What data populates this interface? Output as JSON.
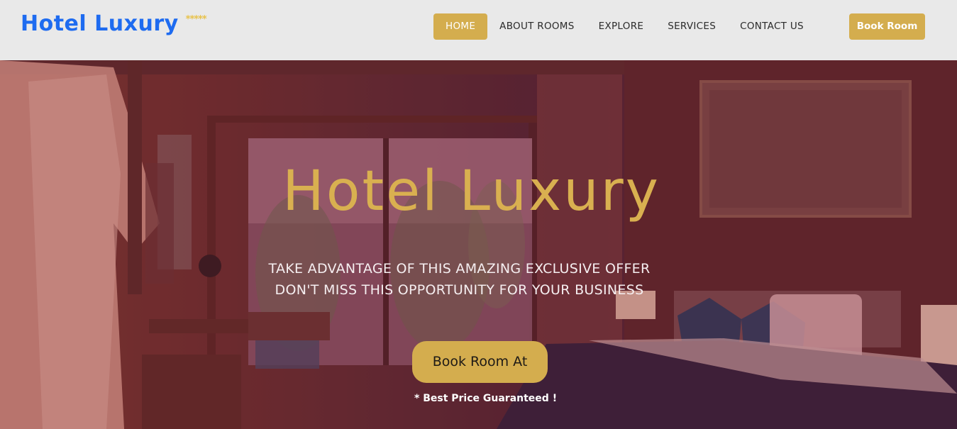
{
  "brand": {
    "name": "Hotel Luxury",
    "stars": "*****"
  },
  "nav": {
    "items": [
      {
        "label": "HOME",
        "active": true
      },
      {
        "label": "ABOUT ROOMS",
        "active": false
      },
      {
        "label": "EXPLORE",
        "active": false
      },
      {
        "label": "SERVICES",
        "active": false
      },
      {
        "label": "CONTACT US",
        "active": false
      }
    ],
    "book_label": "Book Room"
  },
  "hero": {
    "title": "Hotel Luxury",
    "tagline_1": "TAKE ADVANTAGE OF THIS AMAZING EXCLUSIVE OFFER",
    "tagline_2": "DON'T MISS THIS OPPORTUNITY FOR YOUR BUSINESS",
    "cta_label": "Book Room At",
    "guarantee": "* Best Price Guaranteed !"
  },
  "colors": {
    "brand_blue": "#1e6bf0",
    "gold": "#d4ad4e",
    "header_bg": "#e9e9e9"
  }
}
